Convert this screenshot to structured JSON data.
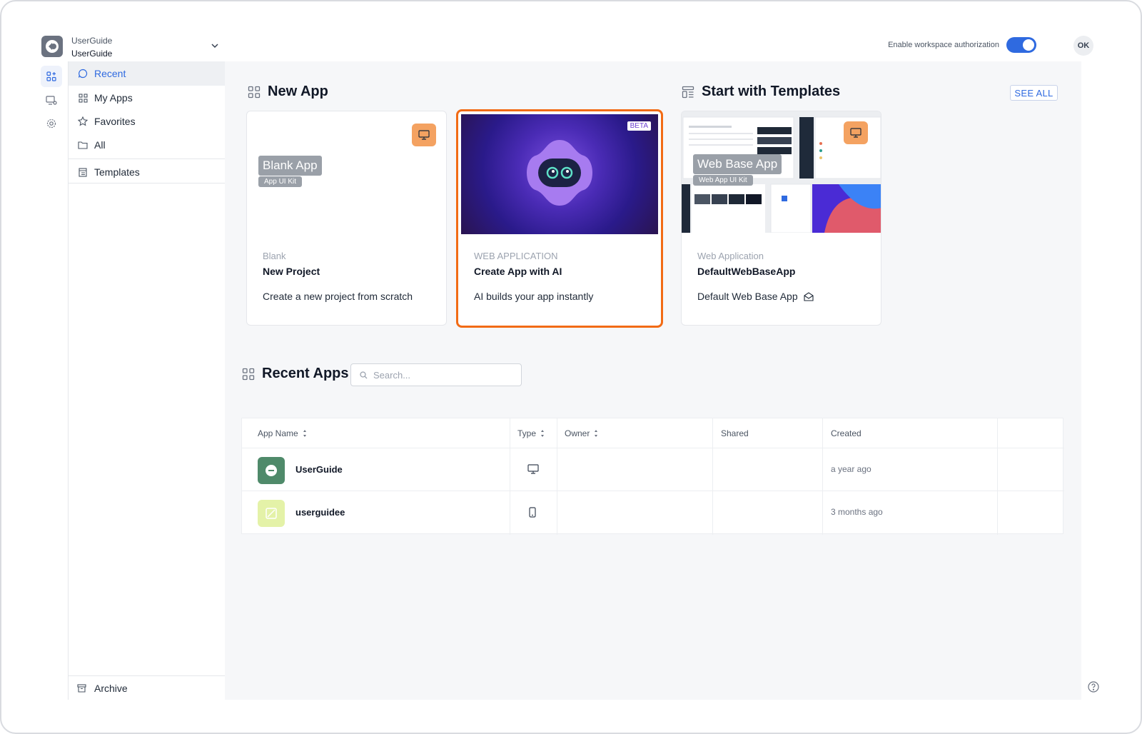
{
  "workspace": {
    "name_line1": "UserGuide",
    "name_line2": "UserGuide"
  },
  "sidebar": {
    "items": [
      {
        "label": "Recent",
        "icon": "chat-bubble-icon"
      },
      {
        "label": "My Apps",
        "icon": "grid-icon"
      },
      {
        "label": "Favorites",
        "icon": "star-icon"
      },
      {
        "label": "All",
        "icon": "folder-icon"
      },
      {
        "label": "Templates",
        "icon": "template-icon"
      }
    ],
    "archive_label": "Archive"
  },
  "topbar": {
    "auth_label": "Enable workspace authorization",
    "auth_enabled": true,
    "avatar_initials": "OK"
  },
  "new_app": {
    "title": "New App",
    "blank": {
      "chip": "Blank App",
      "chip_sub": "App UI Kit",
      "subtitle": "Blank",
      "title": "New Project",
      "description": "Create a new project from scratch"
    },
    "ai": {
      "badge": "BETA",
      "subtitle": "WEB APPLICATION",
      "title": "Create App with AI",
      "description": "AI builds your app instantly"
    }
  },
  "templates": {
    "title": "Start with Templates",
    "see_all": "SEE ALL",
    "card": {
      "chip": "Web Base App",
      "chip_sub": "Web App UI Kit",
      "subtitle": "Web Application",
      "title": "DefaultWebBaseApp",
      "description": "Default Web Base App"
    }
  },
  "recent_apps": {
    "title": "Recent Apps",
    "search_placeholder": "Search...",
    "columns": [
      "App Name",
      "Type",
      "Owner",
      "Shared",
      "Created"
    ],
    "rows": [
      {
        "name": "UserGuide",
        "type": "desktop-icon",
        "owner": "",
        "shared": "",
        "created": "a year ago",
        "icon_color": "#4f8a6a"
      },
      {
        "name": "userguidee",
        "type": "mobile-icon",
        "owner": "",
        "shared": "",
        "created": "3 months ago",
        "icon_color": "#e4f2a8"
      }
    ]
  },
  "colors": {
    "accent": "#2f6ae0",
    "highlight": "#f26b15",
    "badge": "#f4a261"
  }
}
